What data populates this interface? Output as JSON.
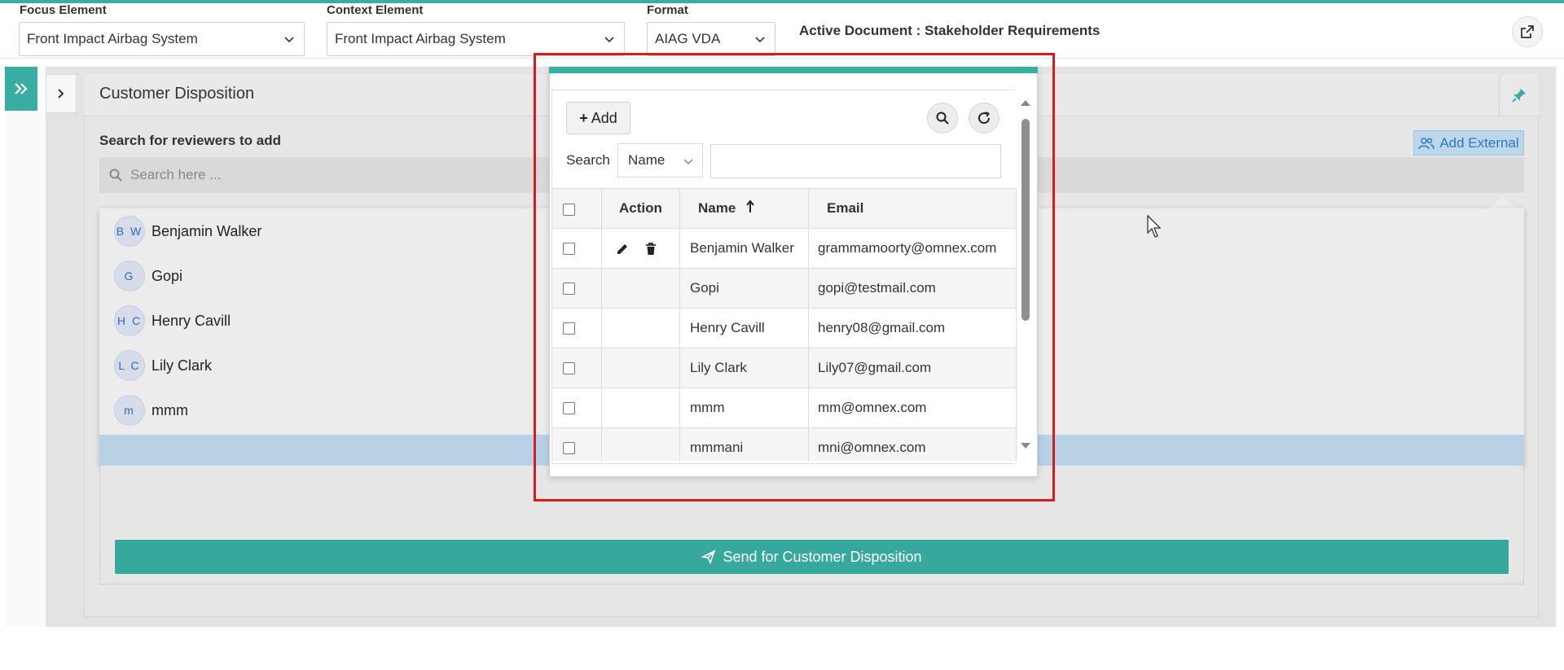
{
  "topbar": {
    "focus_label": "Focus Element",
    "focus_value": "Front Impact Airbag System",
    "context_label": "Context Element",
    "context_value": "Front Impact Airbag System",
    "format_label": "Format",
    "format_value": "AIAG VDA",
    "active_document": "Active Document : Stakeholder Requirements"
  },
  "panel": {
    "title": "Customer Disposition",
    "search_label": "Search for reviewers to add",
    "search_placeholder": "Search here ...",
    "add_external": "Add External",
    "send_button": "Send for Customer Disposition"
  },
  "dropdown": {
    "items": [
      {
        "initials": "B W",
        "name": "Benjamin Walker"
      },
      {
        "initials": "G",
        "name": "Gopi"
      },
      {
        "initials": "H C",
        "name": "Henry Cavill"
      },
      {
        "initials": "L C",
        "name": "Lily Clark"
      },
      {
        "initials": "m",
        "name": "mmm"
      }
    ]
  },
  "popup": {
    "add_label": "Add",
    "search_label": "Search",
    "search_field": "Name",
    "columns": {
      "action": "Action",
      "name": "Name",
      "email": "Email"
    },
    "rows": [
      {
        "name": "Benjamin Walker",
        "email": "grammamoorty@omnex.com"
      },
      {
        "name": "Gopi",
        "email": "gopi@testmail.com"
      },
      {
        "name": "Henry Cavill",
        "email": "henry08@gmail.com"
      },
      {
        "name": "Lily Clark",
        "email": "Lily07@gmail.com"
      },
      {
        "name": "mmm",
        "email": "mm@omnex.com"
      },
      {
        "name": "mmmani",
        "email": "mni@omnex.com"
      }
    ]
  },
  "colors": {
    "accent": "#3aada2",
    "highlight": "#d81c1c",
    "link": "#2a7bbf"
  }
}
